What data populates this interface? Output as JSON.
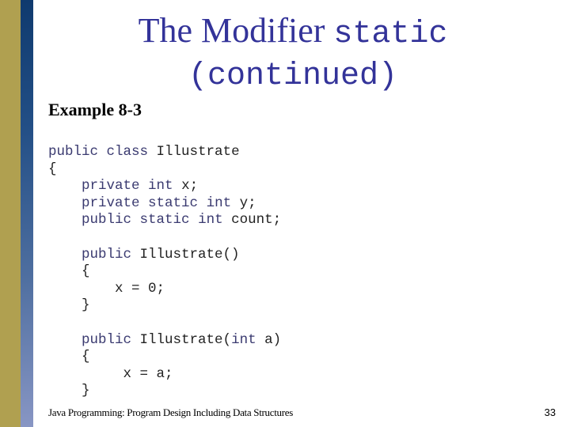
{
  "title": {
    "text": "The Modifier",
    "code_word": "static",
    "line2": "(continued)"
  },
  "example_label": "Example 8-3",
  "code_lines": [
    "public class Illustrate",
    "{",
    "    private int x;",
    "    private static int y;",
    "    public static int count;",
    "",
    "    public Illustrate()",
    "    {",
    "        x = 0;",
    "    }",
    "",
    "    public Illustrate(int a)",
    "    {",
    "         x = a;",
    "    }"
  ],
  "footer": {
    "text": "Java Programming: Program Design Including Data Structures",
    "page_number": "33"
  },
  "colors": {
    "title": "#333399",
    "left_bar_gold": "#b0a050",
    "left_bar_blue": "#0f3a6e"
  }
}
